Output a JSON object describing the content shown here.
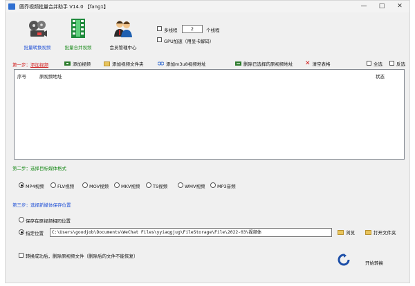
{
  "window": {
    "title": "圆乔视频批量合并助手 V14.0 【fang1】",
    "controls": [
      "—",
      "□",
      "✕"
    ]
  },
  "toolbar": {
    "batch_convert": "批量转换视频",
    "batch_merge": "批量合并视频",
    "member_center": "会员管理中心",
    "multithread_label": "多线程",
    "thread_count": "2",
    "thread_unit": "个线程",
    "gpu_label": "GPU加速（用显卡解码）"
  },
  "step1": {
    "prefix": "第一步：",
    "label": "添加视频",
    "buttons": [
      "添加视频",
      "添加视频文件夹",
      "添加m3u8视频地址",
      "删除已选择的原视频地址",
      "清空表格"
    ],
    "select_all": "全选",
    "invert": "反选",
    "columns": [
      "序号",
      "原视频地址",
      "状态"
    ]
  },
  "step2": {
    "label": "第二步：选择目标媒体格式",
    "formats": [
      "MP4视频",
      "FLV视频",
      "MOV视频",
      "MKV视频",
      "TS视频",
      "WMV视频",
      "MP3音频"
    ],
    "selected": "MP4视频"
  },
  "step3": {
    "label": "第三步：选择新媒体保存位置",
    "option_same": "保存在原视频相同位置",
    "option_custom": "指定位置",
    "path": "C:\\Users\\goodjob\\Documents\\WeChat Files\\yyiaqgjug\\FileStorage\\File\\2022-03\\视频体",
    "browse": "浏览",
    "open_folder": "打开文件夹"
  },
  "bottom": {
    "delete_after": "转换成功后，删除原视频文件（删除后的文件不能恢复）",
    "start": "开始转换"
  },
  "colors": {
    "step_red": "#d01818",
    "link_blue": "#1e4fd6",
    "green": "#1a8a1a"
  }
}
